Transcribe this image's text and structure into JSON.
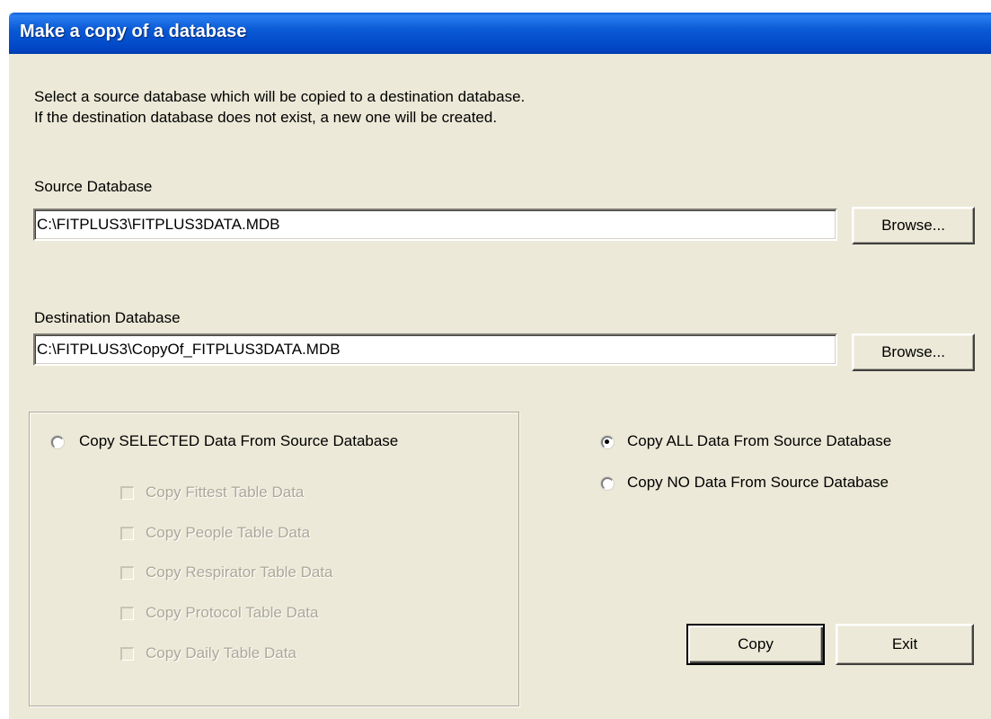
{
  "window": {
    "title": "Make a copy of a database"
  },
  "intro": {
    "line1": "Select a source database which will be copied to a destination database.",
    "line2": "If the destination database does not exist, a new one will be created."
  },
  "source": {
    "label": "Source Database",
    "value": "C:\\FITPLUS3\\FITPLUS3DATA.MDB",
    "browse_label": "Browse..."
  },
  "destination": {
    "label": "Destination Database",
    "value": "C:\\FITPLUS3\\CopyOf_FITPLUS3DATA.MDB",
    "browse_label": "Browse..."
  },
  "options": {
    "selected": {
      "label": "Copy SELECTED Data From Source Database",
      "checked": false,
      "tables": [
        {
          "label": "Copy Fittest Table Data",
          "checked": false,
          "enabled": false
        },
        {
          "label": "Copy People Table Data",
          "checked": false,
          "enabled": false
        },
        {
          "label": "Copy Respirator Table Data",
          "checked": false,
          "enabled": false
        },
        {
          "label": "Copy Protocol Table Data",
          "checked": false,
          "enabled": false
        },
        {
          "label": "Copy Daily Table Data",
          "checked": false,
          "enabled": false
        }
      ]
    },
    "all": {
      "label": "Copy ALL Data From Source Database",
      "checked": true
    },
    "none": {
      "label": "Copy NO Data From Source Database",
      "checked": false
    }
  },
  "actions": {
    "copy_label": "Copy",
    "exit_label": "Exit"
  },
  "colors": {
    "titlebar": "#0b5ad6",
    "dialog_background": "#ece9d8",
    "disabled_text": "#aca899"
  }
}
